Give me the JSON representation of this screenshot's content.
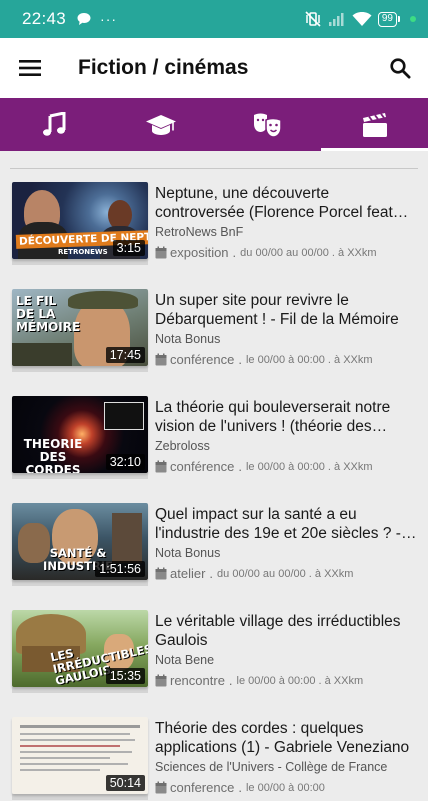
{
  "status_bar": {
    "time": "22:43",
    "more": "···",
    "battery": "99"
  },
  "app_bar": {
    "title": "Fiction / cinémas"
  },
  "tabs": [
    {
      "icon": "music-note-icon"
    },
    {
      "icon": "graduation-cap-icon"
    },
    {
      "icon": "theater-masks-icon"
    },
    {
      "icon": "clapperboard-icon",
      "active": true
    }
  ],
  "colors": {
    "status": "#26a69a",
    "tabs": "#7b1e7a",
    "background": "#ececec"
  },
  "videos": [
    {
      "title": "Neptune, une découverte controversée (Florence Porcel feat Roland Lehoucq)",
      "channel": "RetroNews BnF",
      "type": "exposition",
      "when": "du 00/00 au 00/00 . à XXkm",
      "duration": "3:15",
      "thumb_caption": "DÉCOUVERTE DE NEPTUNE",
      "thumb_sub": "RETRONEWS"
    },
    {
      "title": "Un super site pour revivre le Débarquement ! - Fil de la Mémoire",
      "channel": "Nota Bonus",
      "type": "conférence",
      "when": "le 00/00 à 00:00 . à XXkm",
      "duration": "17:45",
      "thumb_caption": "LE FIL DE LA MÉMOIRE"
    },
    {
      "title": "La théorie qui bouleverserait notre vision de l'univers ! (théorie des cordes)",
      "channel": "Zebroloss",
      "type": "conférence",
      "when": "le 00/00 à 00:00 . à XXkm",
      "duration": "32:10",
      "thumb_caption": "THEORIE DES CORDES"
    },
    {
      "title": "Quel impact sur la santé a eu l'industrie des 19e et 20e siècles ? - Nota Bonus",
      "channel": "Nota Bonus",
      "type": "atelier",
      "when": "du 00/00 au 00/00 . à XXkm",
      "duration": "1:51:56",
      "thumb_caption": "SANTÉ & INDUSTRIE"
    },
    {
      "title": "Le véritable village des irréductibles Gaulois",
      "channel": "Nota Bene",
      "type": "rencontre",
      "when": "le 00/00 à 00:00 . à XXkm",
      "duration": "15:35",
      "thumb_caption": "LES IRRÉDUCTIBLES GAULOIS"
    },
    {
      "title": "Théorie des cordes : quelques applications (1) - Gabriele Veneziano",
      "channel": "Sciences de l'Univers - Collège de France",
      "type": "conference",
      "when": "le 00/00 à 00:00",
      "duration": "50:14",
      "thumb_caption": ""
    }
  ]
}
